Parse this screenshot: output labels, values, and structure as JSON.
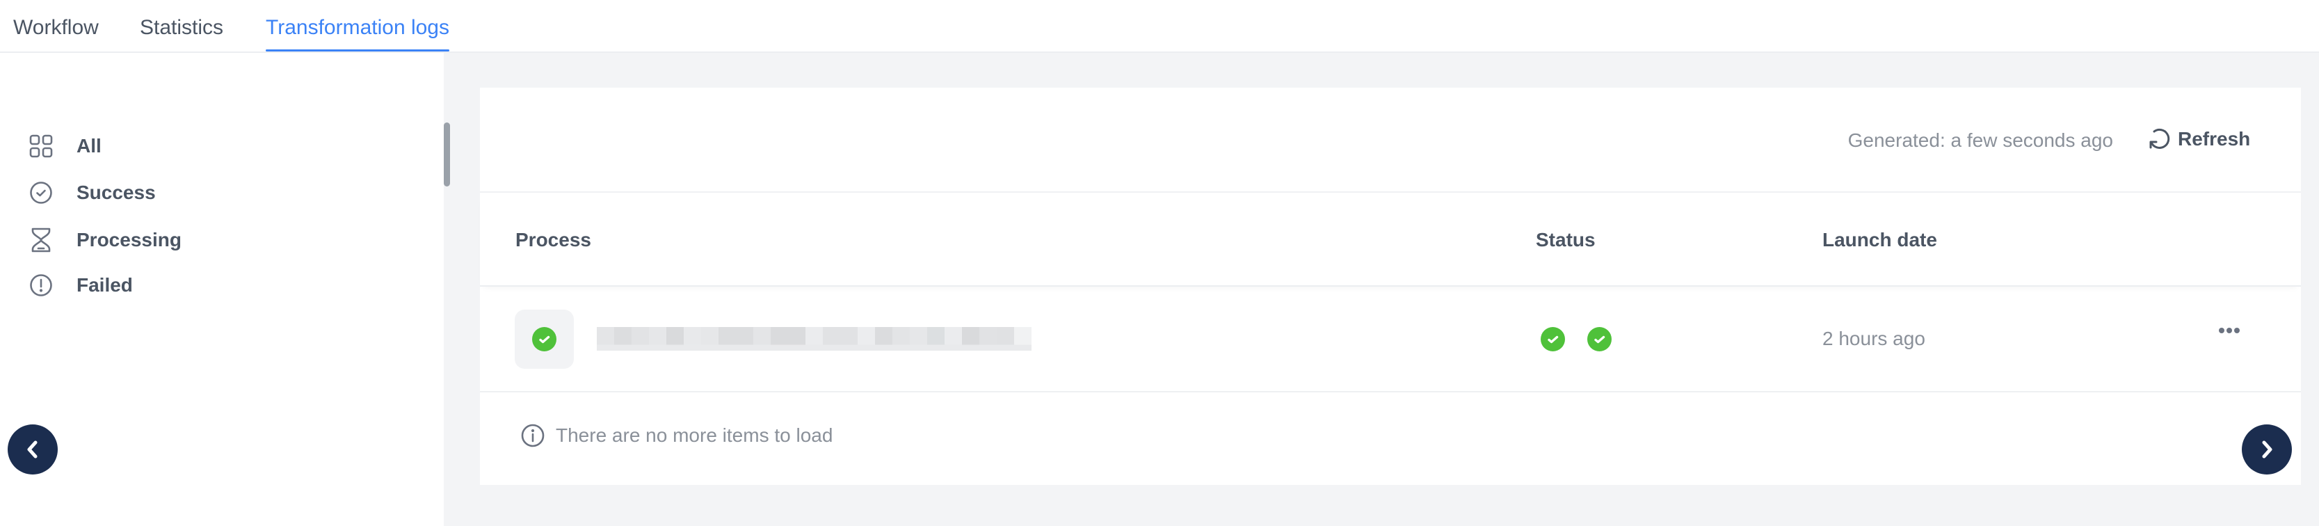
{
  "tabs": [
    {
      "label": "Workflow",
      "active": false
    },
    {
      "label": "Statistics",
      "active": false
    },
    {
      "label": "Transformation logs",
      "active": true
    }
  ],
  "accent_color": "#3b82f6",
  "sidebar": {
    "items": [
      {
        "label": "All",
        "icon": "grid-icon"
      },
      {
        "label": "Success",
        "icon": "check-circle-icon"
      },
      {
        "label": "Processing",
        "icon": "hourglass-icon"
      },
      {
        "label": "Failed",
        "icon": "alert-circle-icon"
      }
    ]
  },
  "toolbar": {
    "generated_text": "Generated: a few seconds ago",
    "refresh_label": "Refresh"
  },
  "table": {
    "columns": [
      "Process",
      "Status",
      "Launch date"
    ],
    "rows": [
      {
        "process_name": "[redacted]",
        "process_status_icon": "success",
        "status_icons": [
          "success",
          "success"
        ],
        "launch_date": "2 hours ago"
      }
    ],
    "footer_message": "There are no more items to load"
  },
  "status_colors": {
    "success": "#4fc13a"
  },
  "navigation": {
    "prev_icon": "chevron-left-icon",
    "next_icon": "chevron-right-icon"
  }
}
